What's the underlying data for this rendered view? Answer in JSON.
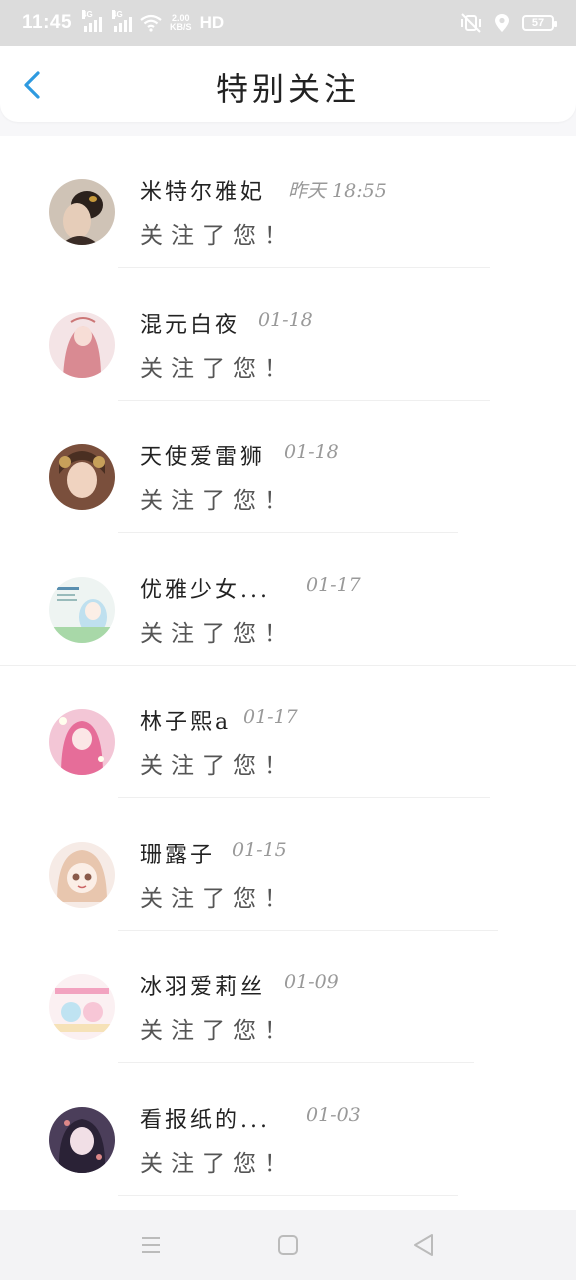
{
  "status_bar": {
    "time": "11:45",
    "net1": "4G",
    "net2": "4G",
    "speed_value": "2.00",
    "speed_unit": "KB/S",
    "hd": "HD",
    "battery": "57",
    "icons": [
      "signal-icon",
      "wifi-icon",
      "mute-vibrate-icon",
      "location-icon",
      "battery-icon"
    ]
  },
  "header": {
    "title": "特别关注",
    "back_icon": "chevron-left-icon",
    "accent_color": "#2e9ae0"
  },
  "list": {
    "items": [
      {
        "name": "米特尔雅妃",
        "time": "昨天 18:55",
        "message": "关注了您！"
      },
      {
        "name": "混元白夜",
        "time": "01-18",
        "message": "关注了您！"
      },
      {
        "name": "天使爱雷狮",
        "time": "01-18",
        "message": "关注了您！"
      },
      {
        "name": "优雅少女...",
        "time": "01-17",
        "message": "关注了您！"
      },
      {
        "name": "林子熙a",
        "time": "01-17",
        "message": "关注了您！"
      },
      {
        "name": "珊露子",
        "time": "01-15",
        "message": "关注了您！"
      },
      {
        "name": "冰羽爱莉丝",
        "time": "01-09",
        "message": "关注了您！"
      },
      {
        "name": "看报纸的...",
        "time": "01-03",
        "message": "关注了您！"
      }
    ]
  },
  "nav_bar": {
    "icons": [
      "menu-icon",
      "home-square-icon",
      "back-triangle-icon"
    ]
  }
}
